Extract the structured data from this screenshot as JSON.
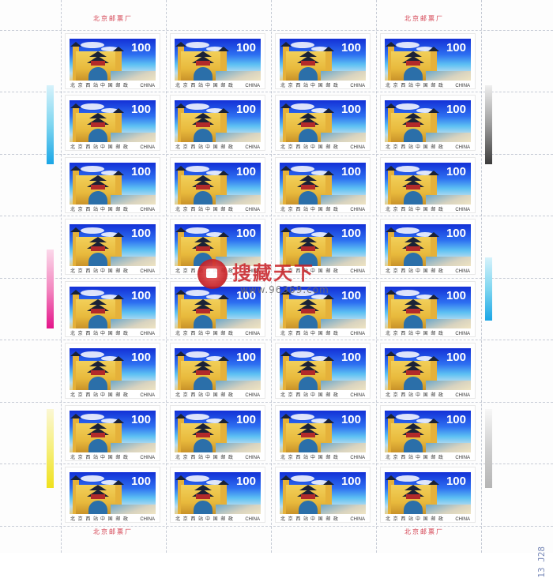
{
  "sheet": {
    "imprint_top_left": "北京邮票厂",
    "imprint_top_right": "北京邮票厂",
    "imprint_bottom_left": "北京邮票厂",
    "imprint_bottom_right": "北京邮票厂",
    "corner_number": "13 J28"
  },
  "stamp": {
    "denomination": "100",
    "station_name": "北 京 西 站",
    "issuer": "中 国 邮 政",
    "country": "CHINA"
  },
  "grid": {
    "rows": 8,
    "cols": 4
  },
  "watermark": {
    "text": "搜藏天下",
    "url": "www.96369.com",
    "logo_icon": "red-circle-logo-icon"
  },
  "colors": {
    "sky_top": "#1330d6",
    "building": "#e8b93c",
    "imprint": "#d33b4b",
    "watermark": "#c81f24"
  },
  "color_bars": {
    "left": [
      "cyan",
      "magenta",
      "yellow"
    ],
    "right": [
      "black",
      "cyan",
      "gray"
    ]
  }
}
